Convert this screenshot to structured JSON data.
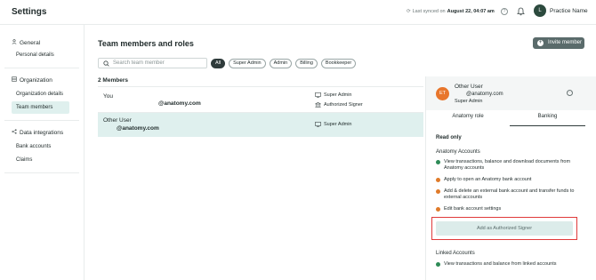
{
  "header": {
    "title": "Settings",
    "sync_prefix": "Last synced on",
    "sync_time": "August 22, 04:07 am",
    "help": "?",
    "avatar_initial": "L",
    "practice_name": "Practice Name"
  },
  "sidebar": {
    "sections": [
      {
        "title": "General",
        "icon": "user-icon",
        "items": [
          "Personal details"
        ]
      },
      {
        "title": "Organization",
        "icon": "building-icon",
        "items": [
          "Organization details",
          "Team members"
        ]
      },
      {
        "title": "Data integrations",
        "icon": "share-icon",
        "items": [
          "Bank accounts",
          "Claims"
        ]
      }
    ],
    "active_item": "Team members"
  },
  "main": {
    "title": "Team members and roles",
    "invite_label": "Invite member",
    "search_placeholder": "Search team member",
    "filters": [
      "All",
      "Super Admin",
      "Admin",
      "Billing",
      "Bookkeeper"
    ],
    "selected_filter": "All",
    "member_count": "2 Members",
    "members": [
      {
        "name": "You",
        "email": "@anatomy.com",
        "roles": [
          "Super Admin",
          "Authorized Signer"
        ]
      },
      {
        "name": "Other User",
        "email": "@anatomy.com",
        "roles": [
          "Super Admin"
        ]
      }
    ]
  },
  "panel": {
    "initials": "ET",
    "name": "Other User",
    "email": "@anatomy.com",
    "role": "Super Admin",
    "tabs": [
      "Anatomy role",
      "Banking"
    ],
    "active_tab": "Banking",
    "access": "Read only",
    "anatomy_accounts_label": "Anatomy Accounts",
    "anatomy_permissions": [
      {
        "text": "View transactions, balance and download documents from Anatomy accounts",
        "allowed": true
      },
      {
        "text": "Apply to open an Anatomy bank account",
        "allowed": false
      },
      {
        "text": "Add & delete an external bank account and transfer funds to external accounts",
        "allowed": false
      },
      {
        "text": "Edit bank account settings",
        "allowed": false
      }
    ],
    "action_label": "Add as Authorized Signer",
    "linked_accounts_label": "Linked Accounts",
    "linked_permissions": [
      {
        "text": "View transactions and balance from linked accounts",
        "allowed": true
      }
    ]
  },
  "colors": {
    "accent_bg": "#dff0ee",
    "dark": "#2f3b3b",
    "ok": "#2e8b57",
    "denied": "#e07b2a",
    "highlight": "#e03a3a"
  }
}
